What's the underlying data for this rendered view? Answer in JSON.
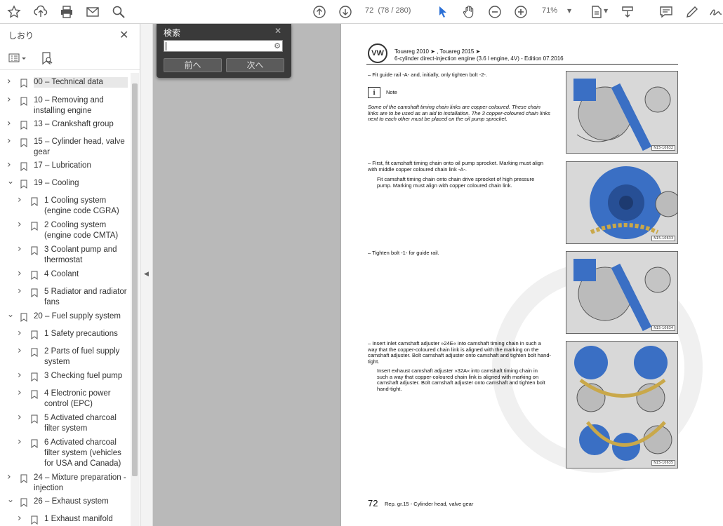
{
  "toolbar": {
    "page_current": "72",
    "page_info": "(78 / 280)",
    "zoom": "71%",
    "icons": [
      "star-icon",
      "upload-icon",
      "print-icon",
      "mail-icon",
      "zoom-search-icon",
      "arrow-up-icon",
      "arrow-down-icon",
      "cursor-icon",
      "hand-icon",
      "zoom-out-icon",
      "zoom-in-icon",
      "page-fit-icon",
      "scroll-icon",
      "comment-icon",
      "pen-icon",
      "sign-icon"
    ]
  },
  "sidebar": {
    "title": "しおり",
    "bookmarks": [
      {
        "label": "00 – Technical data",
        "level": 0,
        "expanded": false,
        "selected": true
      },
      {
        "label": "10 – Removing and installing engine",
        "level": 0,
        "expanded": false
      },
      {
        "label": "13 – Crankshaft group",
        "level": 0,
        "expanded": false
      },
      {
        "label": "15 – Cylinder head, valve gear",
        "level": 0,
        "expanded": false
      },
      {
        "label": "17 – Lubrication",
        "level": 0,
        "expanded": false
      },
      {
        "label": "19 – Cooling",
        "level": 0,
        "expanded": true
      },
      {
        "label": "1 Cooling system (engine code CGRA)",
        "level": 1,
        "expanded": false
      },
      {
        "label": "2 Cooling system (engine code CMTA)",
        "level": 1,
        "expanded": false
      },
      {
        "label": "3 Coolant pump and thermostat",
        "level": 1,
        "expanded": false
      },
      {
        "label": "4 Coolant",
        "level": 1,
        "expanded": false
      },
      {
        "label": "5 Radiator and radiator fans",
        "level": 1,
        "expanded": false
      },
      {
        "label": "20 – Fuel supply system",
        "level": 0,
        "expanded": true
      },
      {
        "label": "1 Safety precautions",
        "level": 1,
        "expanded": false
      },
      {
        "label": "2 Parts of fuel supply system",
        "level": 1,
        "expanded": false
      },
      {
        "label": "3 Checking fuel pump",
        "level": 1,
        "expanded": false
      },
      {
        "label": "4 Electronic power control (EPC)",
        "level": 1,
        "expanded": false
      },
      {
        "label": "5 Activated charcoal filter system",
        "level": 1,
        "expanded": false
      },
      {
        "label": "6 Activated charcoal filter system (vehicles for USA and Canada)",
        "level": 1,
        "expanded": false
      },
      {
        "label": "24 – Mixture preparation - injection",
        "level": 0,
        "expanded": false
      },
      {
        "label": "26 – Exhaust system",
        "level": 0,
        "expanded": true
      },
      {
        "label": "1 Exhaust manifold",
        "level": 1,
        "expanded": false
      }
    ]
  },
  "search": {
    "title": "検索",
    "value": "",
    "prev_label": "前へ",
    "next_label": "次へ"
  },
  "document": {
    "header_line1": "Touareg 2010 ➤ , Touareg 2015 ➤",
    "header_line2": "6-cylinder direct-injection engine (3.6 l engine, 4V) - Edition 07.2016",
    "step1": "–   Fit guide rail -A- and, initially, only tighten bolt -2-.",
    "note_title": "Note",
    "note_text": "Some of the camshaft timing chain links are copper coloured. These chain links are to be used as an aid to installation. The 3 copper-coloured chain links next to each other must be placed on the oil pump sprocket.",
    "step2a": "–   First, fit camshaft timing chain onto oil pump sprocket. Marking must align with middle copper coloured chain link -A-.",
    "step2b": "Fit camshaft timing chain onto chain drive sprocket of high pressure pump. Marking must align with copper coloured chain link.",
    "step3": "–   Tighten bolt -1- for guide rail.",
    "step4a": "–   Insert inlet camshaft adjuster »24E« into camshaft timing chain in such a way that the copper-coloured chain link is aligned with the marking on the camshaft adjuster. Bolt camshaft adjuster onto camshaft and tighten bolt hand-tight.",
    "step4b": "Insert exhaust camshaft adjuster »32A« into camshaft timing chain in such a way that copper-coloured chain link is aligned with marking on camshaft adjuster. Bolt camshaft adjuster onto camshaft and tighten bolt hand-tight.",
    "footer_page": "72",
    "footer_text": "Rep. gr.15 - Cylinder head, valve gear",
    "figure_tags": [
      "N15-10632",
      "N15-10633",
      "N15-10634",
      "N15-10635"
    ]
  },
  "colors": {
    "engine_blue": "#3a6fc4",
    "chain_gold": "#c9a84a"
  }
}
